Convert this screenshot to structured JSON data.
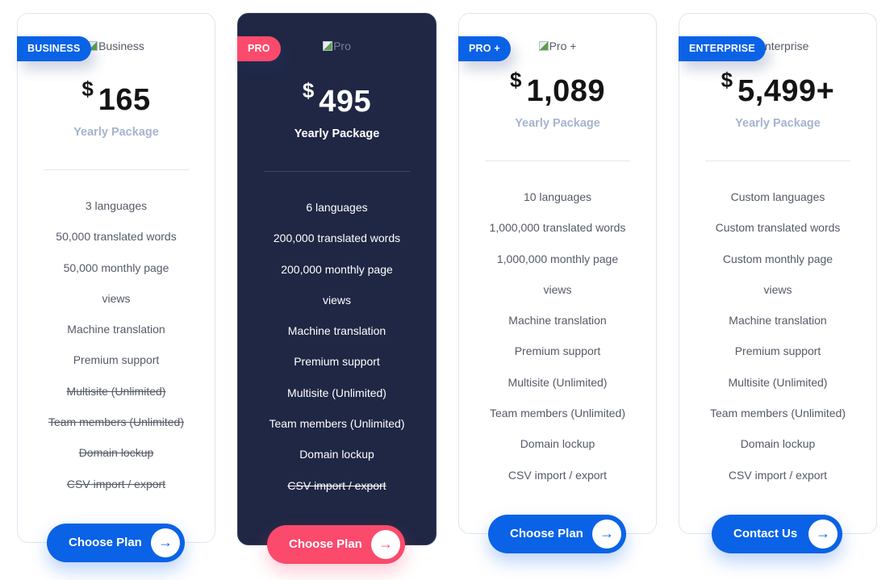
{
  "plans": [
    {
      "badge": "BUSINESS",
      "image_alt": "Business",
      "currency": "$",
      "price": "165",
      "period": "Yearly Package",
      "features": [
        {
          "text": "3 languages",
          "included": true
        },
        {
          "text": "50,000 translated words",
          "included": true
        },
        {
          "text": "50,000 monthly page",
          "included": true
        },
        {
          "text": "views",
          "included": true
        },
        {
          "text": "Machine translation",
          "included": true
        },
        {
          "text": "Premium support",
          "included": true
        },
        {
          "text": "Multisite (Unlimited)",
          "included": false
        },
        {
          "text": "Team members (Unlimited)",
          "included": false
        },
        {
          "text": "Domain lockup",
          "included": false
        },
        {
          "text": "CSV import / export",
          "included": false
        }
      ],
      "cta_label": "Choose Plan",
      "cta_icon": "arrow-right-icon"
    },
    {
      "badge": "PRO",
      "image_alt": "Pro",
      "currency": "$",
      "price": "495",
      "period": "Yearly Package",
      "features": [
        {
          "text": "6 languages",
          "included": true
        },
        {
          "text": "200,000 translated words",
          "included": true
        },
        {
          "text": "200,000 monthly page",
          "included": true
        },
        {
          "text": "views",
          "included": true
        },
        {
          "text": "Machine translation",
          "included": true
        },
        {
          "text": "Premium support",
          "included": true
        },
        {
          "text": "Multisite (Unlimited)",
          "included": true
        },
        {
          "text": "Team members (Unlimited)",
          "included": true
        },
        {
          "text": "Domain lockup",
          "included": true
        },
        {
          "text": "CSV import / export",
          "included": false
        }
      ],
      "cta_label": "Choose Plan",
      "cta_icon": "arrow-right-icon"
    },
    {
      "badge": "PRO +",
      "image_alt": "Pro +",
      "currency": "$",
      "price": "1,089",
      "period": "Yearly Package",
      "features": [
        {
          "text": "10 languages",
          "included": true
        },
        {
          "text": "1,000,000 translated words",
          "included": true
        },
        {
          "text": "1,000,000 monthly page",
          "included": true
        },
        {
          "text": "views",
          "included": true
        },
        {
          "text": "Machine translation",
          "included": true
        },
        {
          "text": "Premium support",
          "included": true
        },
        {
          "text": "Multisite (Unlimited)",
          "included": true
        },
        {
          "text": "Team members (Unlimited)",
          "included": true
        },
        {
          "text": "Domain lockup",
          "included": true
        },
        {
          "text": "CSV import / export",
          "included": true
        }
      ],
      "cta_label": "Choose Plan",
      "cta_icon": "arrow-right-icon"
    },
    {
      "badge": "ENTERPRISE",
      "image_alt": "Enterprise",
      "currency": "$",
      "price": "5,499+",
      "period": "Yearly Package",
      "features": [
        {
          "text": "Custom languages",
          "included": true
        },
        {
          "text": "Custom translated words",
          "included": true
        },
        {
          "text": "Custom monthly page",
          "included": true
        },
        {
          "text": "views",
          "included": true
        },
        {
          "text": "Machine translation",
          "included": true
        },
        {
          "text": "Premium support",
          "included": true
        },
        {
          "text": "Multisite (Unlimited)",
          "included": true
        },
        {
          "text": "Team members (Unlimited)",
          "included": true
        },
        {
          "text": "Domain lockup",
          "included": true
        },
        {
          "text": "CSV import / export",
          "included": true
        }
      ],
      "cta_label": "Contact Us",
      "cta_icon": "arrow-right-icon"
    }
  ],
  "colors": {
    "primary_blue": "#0a62e6",
    "accent_pink": "#fb4a6c",
    "featured_card_bg": "#1f2744",
    "period_text": "#a6b4ce",
    "feature_text": "#555a66"
  },
  "icons": {
    "arrow": "→"
  }
}
